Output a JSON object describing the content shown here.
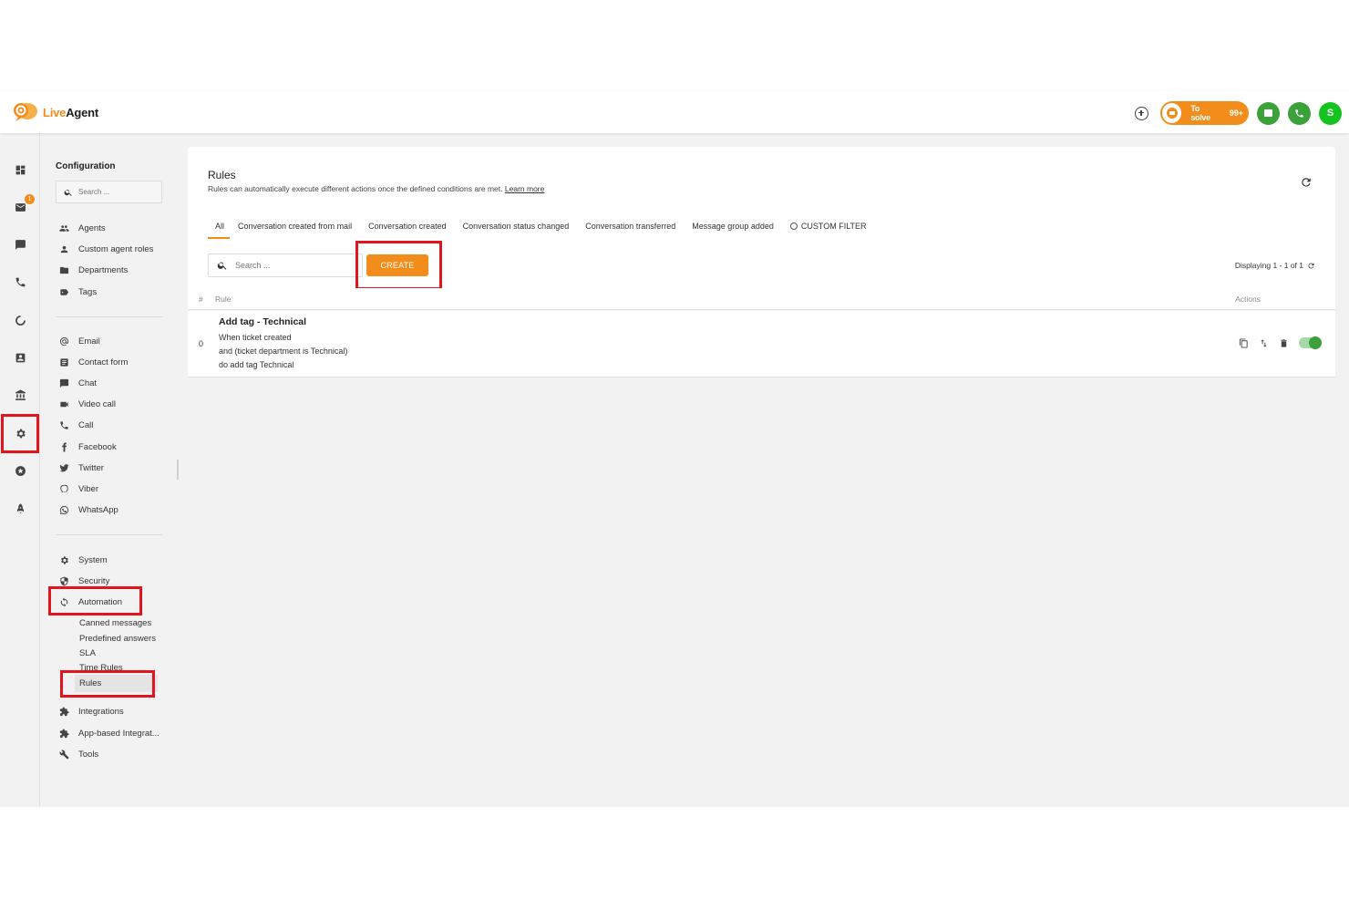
{
  "app": {
    "logo_live": "Live",
    "logo_agent": "Agent"
  },
  "topbar": {
    "tosolve_label": "To solve",
    "tosolve_count": "99+",
    "avatar_initial": "S"
  },
  "rail": {
    "inbox_badge": "1"
  },
  "config": {
    "title": "Configuration",
    "search_placeholder": "Search ...",
    "group1": [
      "Agents",
      "Custom agent roles",
      "Departments",
      "Tags"
    ],
    "group2": [
      "Email",
      "Contact form",
      "Chat",
      "Video call",
      "Call",
      "Facebook",
      "Twitter",
      "Viber",
      "WhatsApp"
    ],
    "group3": [
      "System",
      "Security",
      "Automation"
    ],
    "automation_sub": [
      "Canned messages",
      "Predefined answers",
      "SLA",
      "Time Rules",
      "Rules"
    ],
    "group4": [
      "Integrations",
      "App-based Integrat...",
      "Tools"
    ]
  },
  "main": {
    "title": "Rules",
    "description": "Rules can automatically execute different actions once the defined conditions are met.",
    "learn_more": "Learn more",
    "tabs": [
      "All",
      "Conversation created from mail",
      "Conversation created",
      "Conversation status changed",
      "Conversation transferred",
      "Message group added",
      "CUSTOM FILTER"
    ],
    "search_placeholder": "Search ...",
    "create_label": "CREATE",
    "displaying": "Displaying 1 - 1 of 1",
    "columns": {
      "num": "#",
      "rule": "Rule",
      "actions": "Actions"
    },
    "rows": [
      {
        "index": "0",
        "title": "Add tag - Technical",
        "line1": "When ticket created",
        "line2": "and (ticket department is Technical)",
        "line3": "do add tag Technical",
        "enabled": true
      }
    ]
  },
  "colors": {
    "accent": "#f28c1a",
    "green": "#3ca13a",
    "highlight_box": "#e2141e"
  }
}
